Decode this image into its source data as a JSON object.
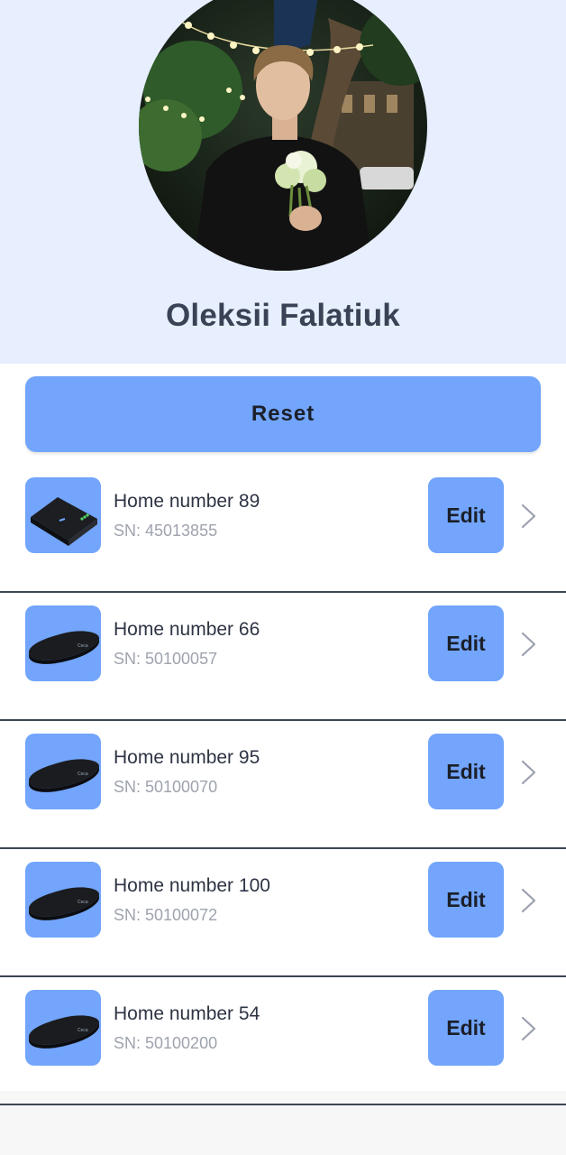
{
  "profile": {
    "name": "Oleksii Falatiuk",
    "avatar_icon": "profile-photo"
  },
  "actions": {
    "reset_label": "Reset"
  },
  "devices": [
    {
      "name": "Home number 89",
      "sn": "SN: 45013855",
      "edit_label": "Edit",
      "thumb": "router-icon"
    },
    {
      "name": "Home number 66",
      "sn": "SN: 50100057",
      "edit_label": "Edit",
      "thumb": "router-icon"
    },
    {
      "name": "Home number 95",
      "sn": "SN: 50100070",
      "edit_label": "Edit",
      "thumb": "router-icon"
    },
    {
      "name": "Home number 100",
      "sn": "SN: 50100072",
      "edit_label": "Edit",
      "thumb": "router-icon"
    },
    {
      "name": "Home number 54",
      "sn": "SN: 50100200",
      "edit_label": "Edit",
      "thumb": "router-icon"
    }
  ],
  "colors": {
    "header_bg": "#e7efff",
    "accent": "#72a5fb",
    "text_dark": "#2e3444",
    "text_muted": "#9ea3ad"
  }
}
